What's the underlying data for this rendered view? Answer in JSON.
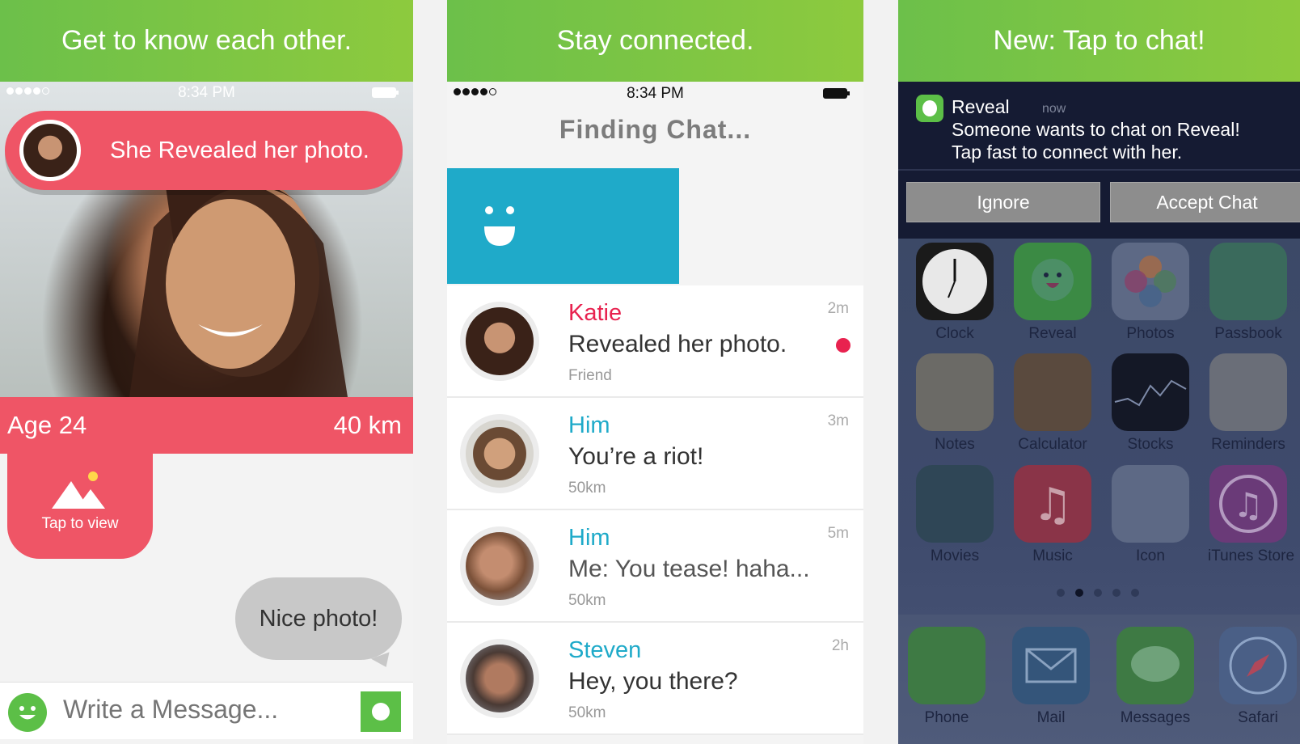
{
  "panel1": {
    "banner": "Get to know each other.",
    "status_time": "8:34 PM",
    "reveal_text": "She Revealed her photo.",
    "age": "Age 24",
    "distance": "40 km",
    "tap_to_view": "Tap to view",
    "bubble": "Nice photo!",
    "composer_placeholder": "Write a Message..."
  },
  "panel2": {
    "banner": "Stay connected.",
    "status_time": "8:34 PM",
    "title": "Finding Chat...",
    "chats": [
      {
        "name": "Katie",
        "name_color": "#e8224f",
        "message": "Revealed her photo.",
        "sub": "Friend",
        "time": "2m",
        "unread": true
      },
      {
        "name": "Him",
        "name_color": "#1faac9",
        "message": "You’re a riot!",
        "sub": "50km",
        "time": "3m",
        "unread": false
      },
      {
        "name": "Him",
        "name_color": "#1faac9",
        "message": "Me: You tease! haha...",
        "sub": "50km",
        "time": "5m",
        "unread": false
      },
      {
        "name": "Steven",
        "name_color": "#1faac9",
        "message": "Hey, you there?",
        "sub": "50km",
        "time": "2h",
        "unread": false
      }
    ]
  },
  "panel3": {
    "banner": "New: Tap to chat!",
    "notification": {
      "app": "Reveal",
      "time": "now",
      "line1": "Someone wants to chat on Reveal!",
      "line2": "Tap fast to connect with her.",
      "ignore": "Ignore",
      "accept": "Accept Chat"
    },
    "apps": [
      "Clock",
      "Reveal",
      "Photos",
      "Passbook",
      "Notes",
      "Calculator",
      "Stocks",
      "Reminders",
      "Movies",
      "Music",
      "Icon",
      "iTunes Store"
    ],
    "dock": [
      "Phone",
      "Mail",
      "Messages",
      "Safari"
    ]
  },
  "colors": {
    "banner_green": "#7cc444",
    "accent_pink": "#ef5566",
    "accent_blue": "#1faac9"
  }
}
